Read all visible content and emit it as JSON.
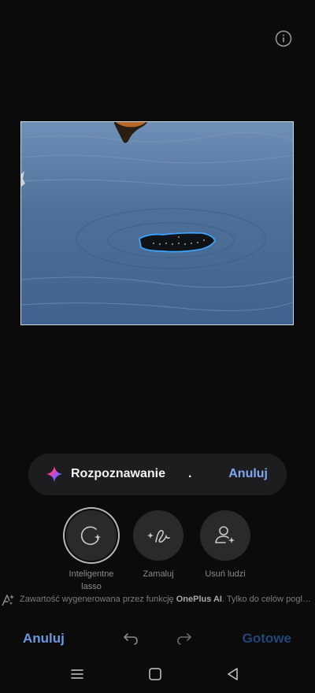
{
  "status_pill": {
    "text": "Rozpoznawanie",
    "dots": ".",
    "cancel_label": "Anuluj"
  },
  "tools": [
    {
      "label": "Inteligentne lasso",
      "icon": "smart-lasso-icon",
      "active": true
    },
    {
      "label": "Zamaluj",
      "icon": "paint-over-icon",
      "active": false
    },
    {
      "label": "Usuń ludzi",
      "icon": "remove-people-icon",
      "active": false
    }
  ],
  "disclaimer": {
    "prefix": "Zawartość wygenerowana przez funkcję ",
    "brand": "OnePlus AI",
    "suffix": ". Tylko do celów poglądowych."
  },
  "bottom_bar": {
    "cancel_label": "Anuluj",
    "done_label": "Gotowe"
  },
  "colors": {
    "background": "#0b0b0c",
    "accent": "#7fa9ef",
    "done_disabled": "#234577"
  }
}
